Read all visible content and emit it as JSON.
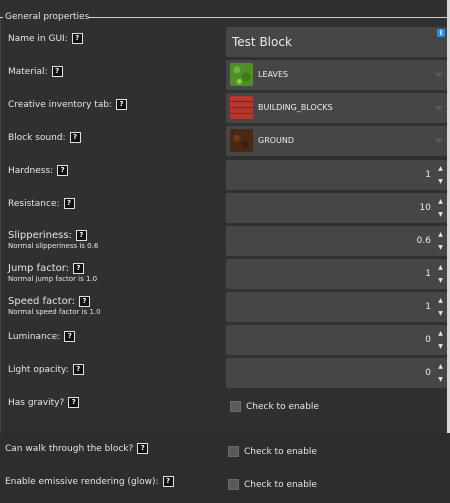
{
  "panel": {
    "title": "General properties",
    "help_glyph": "?",
    "info_glyph": "i"
  },
  "fields": {
    "name_in_gui": {
      "label": "Name in GUI:",
      "value": "Test Block"
    },
    "material": {
      "label": "Material:",
      "value": "LEAVES",
      "icon": "leaves-texture-icon"
    },
    "creative_tab": {
      "label": "Creative inventory tab:",
      "value": "BUILDING_BLOCKS",
      "icon": "bricks-texture-icon"
    },
    "block_sound": {
      "label": "Block sound:",
      "value": "GROUND",
      "icon": "dirt-texture-icon"
    },
    "hardness": {
      "label": "Hardness:",
      "value": "1"
    },
    "resistance": {
      "label": "Resistance:",
      "value": "10"
    },
    "slipperiness": {
      "label": "Slipperiness:",
      "sub": "Normal slipperiness is 0.6",
      "value": "0.6"
    },
    "jump_factor": {
      "label": "Jump factor:",
      "sub": "Normal jump factor is 1.0",
      "value": "1"
    },
    "speed_factor": {
      "label": "Speed factor:",
      "sub": "Normal speed factor is 1.0",
      "value": "1"
    },
    "luminance": {
      "label": "Luminance:",
      "value": "0"
    },
    "light_opacity": {
      "label": "Light opacity:",
      "value": "0"
    },
    "has_gravity": {
      "label": "Has gravity?",
      "checkbox": "Check to enable",
      "checked": false
    },
    "walk_through": {
      "label": "Can walk through the block?",
      "checkbox": "Check to enable",
      "checked": false
    },
    "emissive": {
      "label": "Enable emissive rendering (glow):",
      "checkbox": "Check to enable",
      "checked": false
    }
  },
  "spinner": {
    "up": "▲",
    "down": "▼"
  },
  "colors": {
    "info_badge": "#2b8fe6",
    "field_bg": "#464646",
    "panel_bg": "#303030"
  }
}
